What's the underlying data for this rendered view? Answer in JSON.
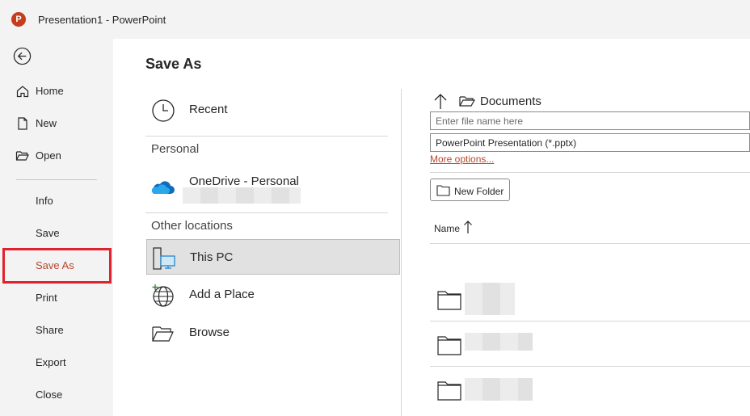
{
  "window": {
    "title": "Presentation1  -  PowerPoint",
    "logo_letter": "P"
  },
  "sidebar": {
    "items": [
      {
        "label": "Home"
      },
      {
        "label": "New"
      },
      {
        "label": "Open"
      },
      {
        "label": "Info"
      },
      {
        "label": "Save"
      },
      {
        "label": "Save As"
      },
      {
        "label": "Print"
      },
      {
        "label": "Share"
      },
      {
        "label": "Export"
      },
      {
        "label": "Close"
      }
    ],
    "active": "Save As"
  },
  "main": {
    "title": "Save As",
    "locations": {
      "recent": "Recent",
      "personal_header": "Personal",
      "onedrive": "OneDrive - Personal",
      "other_header": "Other locations",
      "this_pc": "This PC",
      "add_place": "Add a Place",
      "browse": "Browse"
    },
    "file_panel": {
      "path": "Documents",
      "filename_placeholder": "Enter file name here",
      "filetype": "PowerPoint Presentation (*.pptx)",
      "more_options": "More options...",
      "new_folder": "New Folder",
      "column_name": "Name"
    }
  },
  "colors": {
    "accent": "#b7472a",
    "highlight_box": "#e0212f",
    "logo": "#c43e1c",
    "onedrive": "#0f6cbd"
  }
}
